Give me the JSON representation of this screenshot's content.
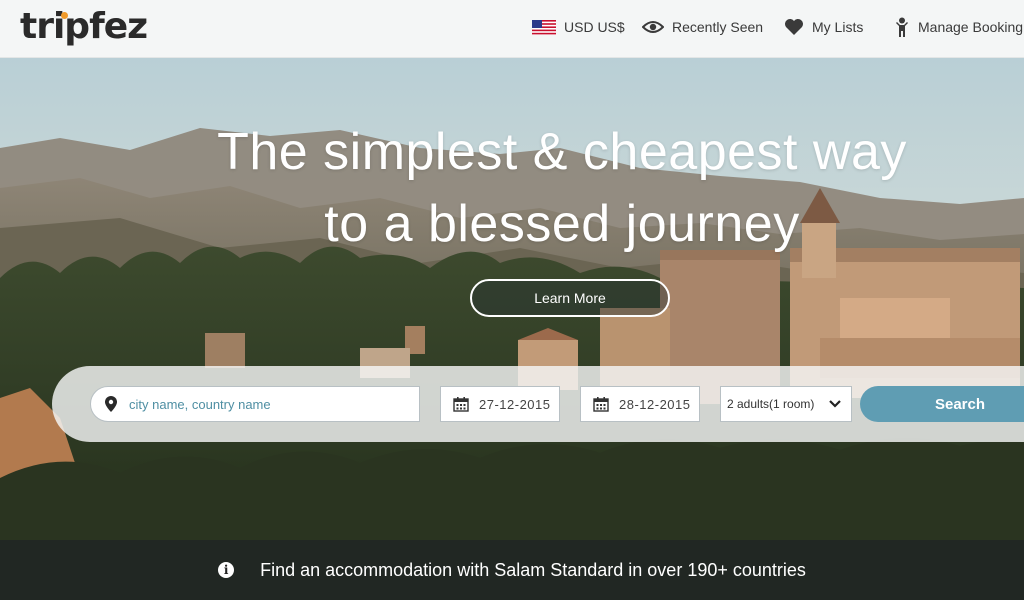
{
  "header": {
    "logo": "tripfez",
    "currency": {
      "label": "USD US$",
      "icon": "us-flag-icon"
    },
    "recently_seen": {
      "label": "Recently Seen",
      "icon": "eye-icon"
    },
    "my_lists": {
      "label": "My Lists",
      "icon": "heart-icon"
    },
    "manage_booking": {
      "label": "Manage Booking",
      "icon": "person-icon"
    }
  },
  "hero": {
    "headline_line1": "The simplest & cheapest way",
    "headline_line2": "to a blessed journey",
    "learn_more": "Learn More"
  },
  "search": {
    "destination_placeholder": "city name, country name",
    "checkin": "27-12-2015",
    "checkout": "28-12-2015",
    "guests": "2 adults(1 room)",
    "button": "Search"
  },
  "infobar": {
    "text": "Find an accommodation with Salam Standard in over 190+ countries"
  },
  "colors": {
    "accent": "#5f9db3",
    "logo_dot": "#f09a2a",
    "placeholder": "#4f8fa3"
  }
}
